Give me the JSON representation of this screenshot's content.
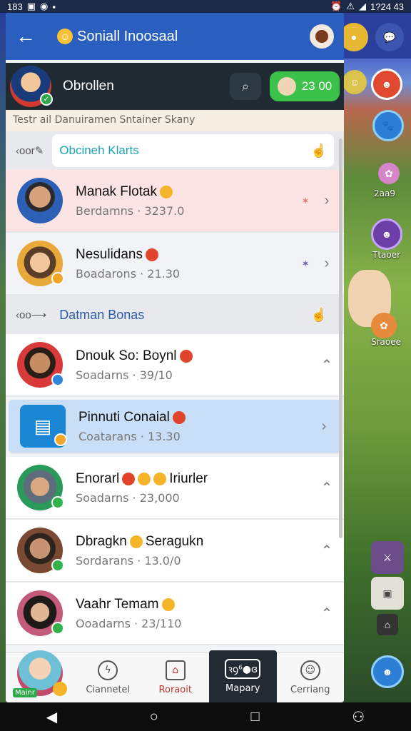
{
  "status": {
    "left_text": "183",
    "time": "1?24 43"
  },
  "appbar": {
    "back_label": "←",
    "title": "Soniall Inoosaal"
  },
  "user": {
    "name": "Obrollen",
    "coins": "23 00"
  },
  "notice": "Testr ail Danuiramen Sntainer Skany",
  "sections": [
    {
      "prefix": "‹oor",
      "title": "Obcineh Klarts"
    },
    {
      "prefix": "‹oo⟶",
      "title": "Datman Bonas"
    }
  ],
  "friends_a": [
    {
      "name": "Manak Flotak",
      "sub": "Berdamns · 3237.0"
    },
    {
      "name": "Nesulidans",
      "sub": "Boadarons · 21.30"
    }
  ],
  "friends_b": [
    {
      "name": "Dnouk So: Boynl",
      "sub": "Soadarns · 39/10"
    },
    {
      "name": "Pinnuti Conaial",
      "sub": "Coatarans · 13.30"
    },
    {
      "name": "Enorarl",
      "name2": "Iriurler",
      "sub": "Soadarns · 23,000"
    },
    {
      "name": "Dbragkn",
      "name2": "Seragukn",
      "sub": "Sordarans · 13.0/0"
    },
    {
      "name": "Vaahr Temam",
      "sub": "Ooadarns · 23/110"
    }
  ],
  "bottomnav": {
    "me_tag": "Mainr",
    "items": [
      "Ciannetel",
      "Roraoit",
      "Mapary",
      "Cerriang"
    ],
    "active_icon_text": "ꝛꝯ⁶●ɞ"
  },
  "game": {
    "label1": "2aa9",
    "label2": "Ttaoer",
    "label3": "Sraoee"
  }
}
